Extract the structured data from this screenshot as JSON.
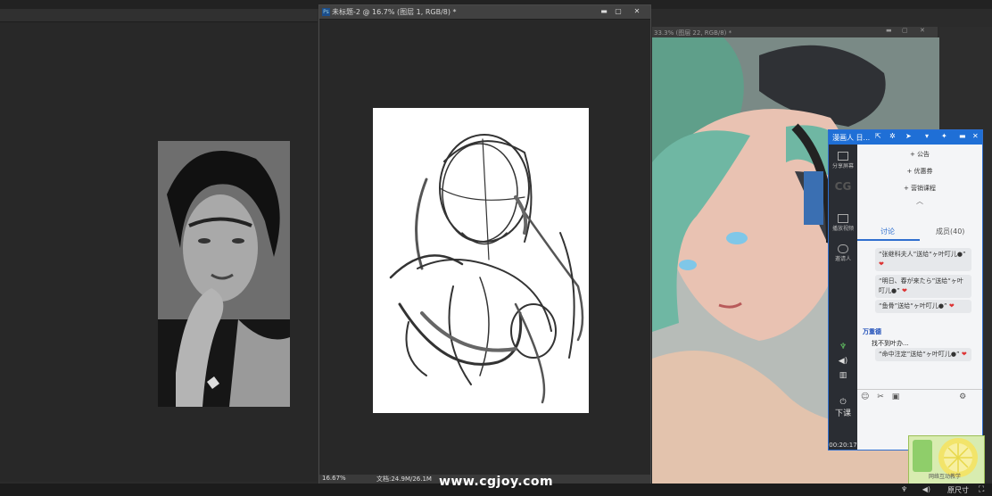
{
  "ps_window": {
    "title": "未标题-2 @ 16.7% (图层 1, RGB/8) *",
    "zoom": "16.67%",
    "doc_info": "文档:24.9M/26.1M",
    "logo": "Ps"
  },
  "paint_window": {
    "title": "33.3% (图层 22, RGB/8) *"
  },
  "window_buttons": {
    "minimize": "▬",
    "maximize": "▢",
    "close": "✕"
  },
  "chat": {
    "title": "漫画人 日...",
    "side_items": [
      "分享屏幕",
      "CG",
      "播放视频",
      "邀请人"
    ],
    "menu": [
      "公告",
      "优惠券",
      "营销课程"
    ],
    "menu_prefix": "+",
    "tabs": [
      "讨论",
      "成员(40)"
    ],
    "messages": [
      "“张继科夫人”送给“ヶ叶叮儿●”",
      "“明日、春が来たら”送给“ヶ叶叮儿●”",
      "“鱼骨”送给“ヶ叶叮儿●”"
    ],
    "last_sender": "万重德",
    "last_text": "找不到叶办...",
    "last_gift": "“命中注定”送给“ヶ叶叮儿●”",
    "leave_label": "下课",
    "timer": "00:20:17"
  },
  "thumbnail": {
    "label": "网络互动教学"
  },
  "watermark": "www.cgjoy.com",
  "bottom_bar": {
    "size_label": "原尺寸"
  },
  "colors": {
    "chat_blue": "#1f6fd6",
    "ps_bg": "#2c2c2c",
    "paper": "#ffffff"
  }
}
